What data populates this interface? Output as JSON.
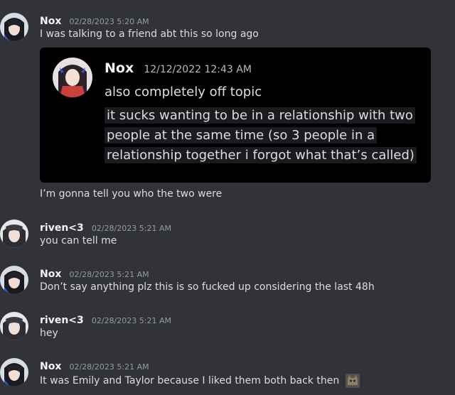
{
  "messages": [
    {
      "author": "Nox",
      "timestamp": "02/28/2023 5:20 AM",
      "lines": [
        "I was talking to a friend abt this so long ago"
      ],
      "avatar_icon": "anime-girl-avatar"
    },
    {
      "lines": [
        "I’m gonna tell you who the two were"
      ]
    },
    {
      "author": "riven<3",
      "timestamp": "02/28/2023 5:21 AM",
      "lines": [
        "you can tell me"
      ],
      "avatar_icon": "anime-girl-avatar"
    },
    {
      "author": "Nox",
      "timestamp": "02/28/2023 5:21 AM",
      "lines": [
        "Don’t say anything plz this is so fucked up considering the last 48h"
      ],
      "avatar_icon": "anime-girl-avatar"
    },
    {
      "author": "riven<3",
      "timestamp": "02/28/2023 5:21 AM",
      "lines": [
        "hey"
      ],
      "avatar_icon": "anime-girl-avatar"
    },
    {
      "author": "Nox",
      "timestamp": "02/28/2023 5:21 AM",
      "lines": [
        "It was Emily and Taylor because I liked them both back then"
      ],
      "avatar_icon": "anime-girl-avatar",
      "trailing_emoji": "cat-emoji"
    }
  ],
  "embed": {
    "author": "Nox",
    "timestamp": "12/12/2022 12:43 AM",
    "lines": [
      "also completely off topic",
      "it sucks wanting to be in a relationship with two",
      "people at the same time (so 3 people in a",
      "relationship together i forgot what that’s called)"
    ],
    "avatar_icon": "anime-girl-avatar"
  },
  "colors": {
    "background": "#313338",
    "embed_background": "#000000",
    "author": "#f2f3f5",
    "timestamp": "#949ba4",
    "text": "#dbdee1"
  }
}
